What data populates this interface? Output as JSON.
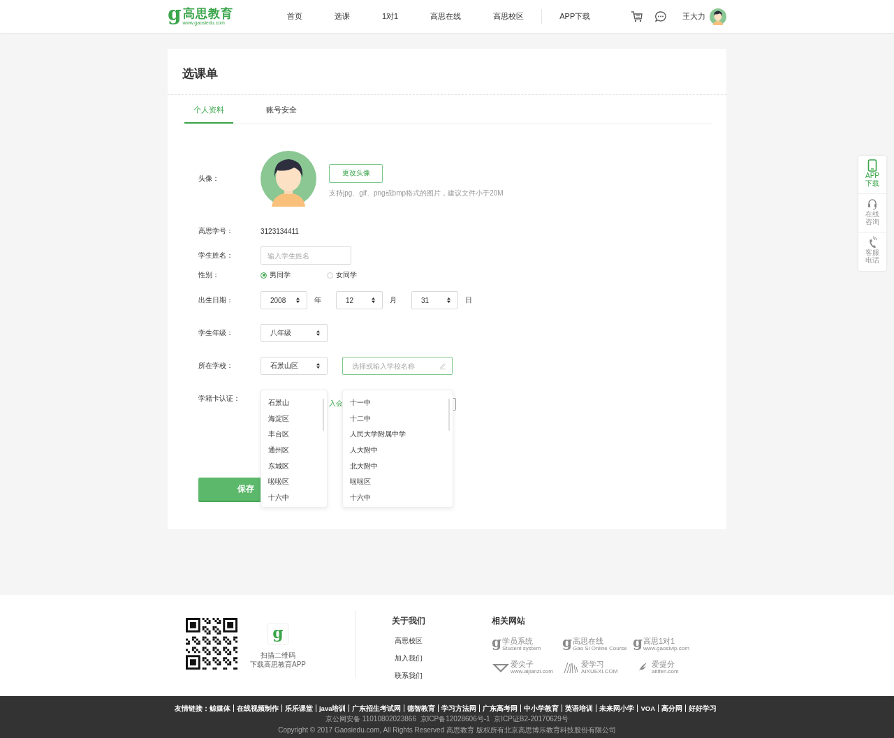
{
  "header": {
    "logo": {
      "mark": "g",
      "name": "高思教育",
      "url": "www.gaosiedu.com"
    },
    "nav": [
      {
        "label": "首页",
        "divider_before": false
      },
      {
        "label": "选课",
        "divider_before": false
      },
      {
        "label": "1对1",
        "divider_before": false
      },
      {
        "label": "高思在线",
        "divider_before": false
      },
      {
        "label": "高思校区",
        "divider_before": false
      },
      {
        "label": "APP下载",
        "divider_before": true
      }
    ],
    "user": {
      "name": "王大力"
    }
  },
  "page": {
    "title": "选课单",
    "tabs": [
      {
        "label": "个人资料",
        "selected": true
      },
      {
        "label": "账号安全",
        "selected": false
      }
    ]
  },
  "form": {
    "avatar": {
      "label": "头像：",
      "button": "更改头像",
      "hint": "支持jpg、gif、png或bmp格式的图片，建议文件小于20M"
    },
    "student_id": {
      "label": "高思学号：",
      "value": "3123134411"
    },
    "name": {
      "label": "学生姓名：",
      "placeholder": "输入学生姓名"
    },
    "gender": {
      "label": "性别：",
      "options": [
        {
          "label": "男同学",
          "selected": true
        },
        {
          "label": "女同学",
          "selected": false
        }
      ]
    },
    "birthday": {
      "label": "出生日期：",
      "parts": [
        {
          "value": "2008",
          "unit": "年"
        },
        {
          "value": "12",
          "unit": "月"
        },
        {
          "value": "31",
          "unit": "日"
        }
      ]
    },
    "grade": {
      "label": "学生年级：",
      "value": "八年级"
    },
    "school": {
      "label": "所在学校：",
      "district": "石景山区",
      "placeholder": "选择或输入学校名称",
      "district_options": [
        "石景山",
        "海淀区",
        "丰台区",
        "通州区",
        "东城区",
        "啦啦区",
        "十六中"
      ],
      "school_options": [
        "十一中",
        "十二中",
        "人民大学附属中学",
        "人大附中",
        "北大附中",
        "啦啦区",
        "十六中"
      ]
    },
    "card": {
      "label": "学籍卡认证：",
      "link_fragment": "入会"
    },
    "save": "保存"
  },
  "side_panel": [
    {
      "kind": "phone",
      "lines": [
        "APP",
        "下载"
      ],
      "selected": true
    },
    {
      "kind": "headset",
      "lines": [
        "在线",
        "咨询"
      ],
      "selected": false
    },
    {
      "kind": "telephone",
      "lines": [
        "客服",
        "电话"
      ],
      "selected": false
    }
  ],
  "footer": {
    "qr_caption": [
      "扫描二维码",
      "下载高思教育APP"
    ],
    "app_mark": "g",
    "about": {
      "title": "关于我们",
      "links": [
        "高思校区",
        "加入我们",
        "联系我们"
      ]
    },
    "sites": {
      "title": "相关网站",
      "items": [
        {
          "kind": "letter",
          "mark": "g",
          "name": "学员系统",
          "sub": "Student system"
        },
        {
          "kind": "letter",
          "mark": "g",
          "name": "高思在线",
          "sub": "Gao Si Online Course"
        },
        {
          "kind": "letter",
          "mark": "g",
          "name": "高思1对1",
          "sub": "www.gaosivip.com"
        },
        {
          "kind": "diamond",
          "name": "爱尖子",
          "sub": "www.aijianzi.com"
        },
        {
          "kind": "sticks",
          "name": "爱学习",
          "sub": "AIXUEXI.COM"
        },
        {
          "kind": "feather",
          "name": "爱提分",
          "sub": "aitifen.com"
        }
      ]
    }
  },
  "bottom": {
    "friends_label": "友情链接：",
    "links": [
      "鲸媒体",
      "在线视频制作",
      "乐乐课堂",
      "java培训",
      "广东招生考试网",
      "德智教育",
      "学习方法网",
      "广东高考网",
      "中小学教育",
      "英语培训",
      "未来网小学",
      "VOA",
      "高分网",
      "好好学习"
    ],
    "icp": "京公网安备 11010802023866  京ICP备12028606号-1  京ICP证B2-20170629号",
    "copyright": "Copyright © 2017 Gaosiedu.com, All Rights Reserved 高思教育 版权所有北京高思博乐教育科技股份有限公司"
  }
}
